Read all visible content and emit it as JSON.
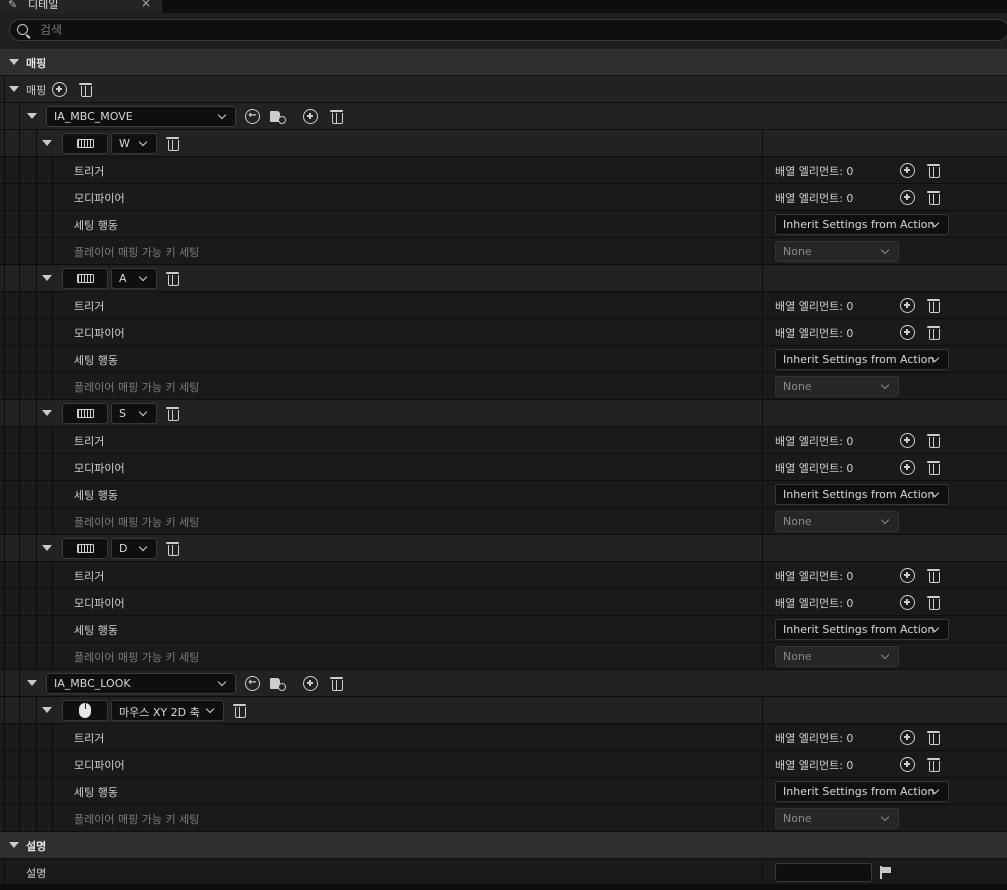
{
  "tab": {
    "title": "디테일",
    "close_icon": "×"
  },
  "search": {
    "placeholder": "검색"
  },
  "categories": {
    "mapping": "매핑",
    "description": "설명"
  },
  "mapping_array": {
    "label": "매핑"
  },
  "props": {
    "trigger": "트리거",
    "modifier": "모디파이어",
    "setting_behavior": "세팅 행동",
    "player_mappable": "플레이어 매핑 가능 키 세팅",
    "array_elements": "배열 엘리먼트: 0",
    "inherit": "Inherit Settings from Action",
    "none": "None"
  },
  "actions": [
    {
      "name": "IA_MBC_MOVE",
      "keys": [
        "W",
        "A",
        "S",
        "D"
      ],
      "key_device": "keyboard"
    },
    {
      "name": "IA_MBC_LOOK",
      "keys": [
        "마우스 XY 2D 축"
      ],
      "key_device": "mouse"
    }
  ],
  "description_row": {
    "label": "설명",
    "value": ""
  },
  "icons": {
    "search": "search-icon",
    "add": "plus-circle-icon",
    "delete": "trash-icon",
    "reset": "reset-arrow-icon",
    "browse": "browse-folder-icon",
    "keyboard": "keyboard-icon",
    "mouse": "mouse-icon",
    "flag": "flag-icon"
  },
  "colors": {
    "background": "#151515",
    "category": "#2f2f2f",
    "property": "#1a1a1a",
    "text": "#cfcfcf"
  }
}
